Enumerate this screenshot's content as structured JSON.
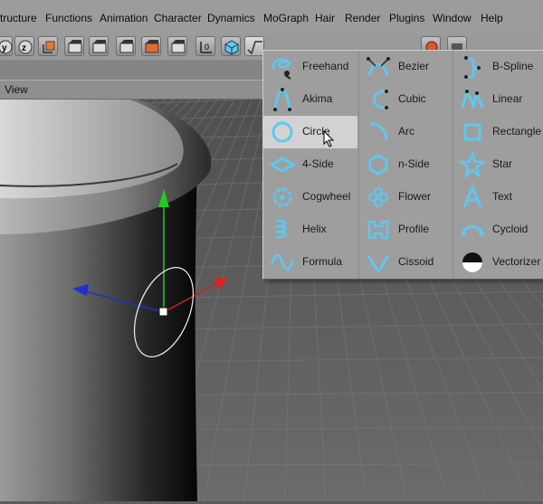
{
  "menubar": {
    "items": [
      "tructure",
      "Functions",
      "Animation",
      "Character",
      "Dynamics",
      "MoGraph",
      "Hair",
      "Render",
      "Plugins",
      "Window",
      "Help"
    ]
  },
  "viewport": {
    "panel_label": "View"
  },
  "spline_menu": {
    "highlighted": "Circle",
    "columns": [
      [
        {
          "label": "Freehand",
          "icon": "freehand-spline-icon"
        },
        {
          "label": "Akima",
          "icon": "akima-spline-icon"
        },
        {
          "label": "Circle",
          "icon": "circle-icon"
        },
        {
          "label": "4-Side",
          "icon": "four-side-icon"
        },
        {
          "label": "Cogwheel",
          "icon": "cogwheel-icon"
        },
        {
          "label": "Helix",
          "icon": "helix-icon"
        },
        {
          "label": "Formula",
          "icon": "formula-icon"
        }
      ],
      [
        {
          "label": "Bezier",
          "icon": "bezier-spline-icon"
        },
        {
          "label": "Cubic",
          "icon": "cubic-spline-icon"
        },
        {
          "label": "Arc",
          "icon": "arc-icon"
        },
        {
          "label": "n-Side",
          "icon": "n-side-icon"
        },
        {
          "label": "Flower",
          "icon": "flower-icon"
        },
        {
          "label": "Profile",
          "icon": "profile-icon"
        },
        {
          "label": "Cissoid",
          "icon": "cissoid-icon"
        }
      ],
      [
        {
          "label": "B-Spline",
          "icon": "b-spline-icon"
        },
        {
          "label": "Linear",
          "icon": "linear-spline-icon"
        },
        {
          "label": "Rectangle",
          "icon": "rectangle-icon"
        },
        {
          "label": "Star",
          "icon": "star-icon"
        },
        {
          "label": "Text",
          "icon": "text-spline-icon"
        },
        {
          "label": "Cycloid",
          "icon": "cycloid-icon"
        },
        {
          "label": "Vectorizer",
          "icon": "vectorizer-icon"
        }
      ]
    ]
  },
  "colors": {
    "icon_accent": "#5ec8f0",
    "menu_bg": "#9e9e9e",
    "highlight_bg": "#d2d2d2"
  }
}
